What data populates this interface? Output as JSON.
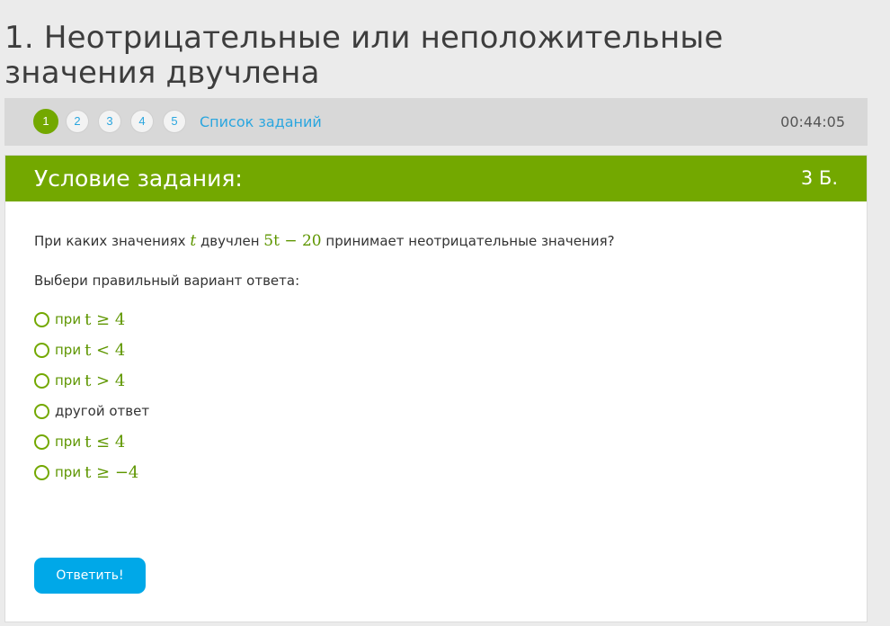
{
  "page": {
    "title": "1. Неотрицательные или неположительные значения двучлена"
  },
  "nav": {
    "pages": [
      "1",
      "2",
      "3",
      "4",
      "5"
    ],
    "active_page": "1",
    "task_list_label": "Список заданий",
    "timer": "00:44:05"
  },
  "task": {
    "header_title": "Условие задания:",
    "points": "3 Б.",
    "question": {
      "part1": "При каких значениях ",
      "var": "t",
      "part2": " двучлен ",
      "expr": "5t − 20",
      "part3": " принимает неотрицательные  значения?"
    },
    "choose_label": "Выбери правильный вариант ответа:",
    "options": [
      {
        "prefix": "при",
        "math": "t ≥ 4"
      },
      {
        "prefix": "при",
        "math": "t < 4"
      },
      {
        "prefix": "при",
        "math": "t > 4"
      },
      {
        "prefix": "",
        "text": "другой ответ"
      },
      {
        "prefix": "при",
        "math": "t ≤ 4"
      },
      {
        "prefix": "при",
        "math": "t ≥ −4"
      }
    ],
    "submit_label": "Ответить!"
  },
  "colors": {
    "accent_green": "#73a800",
    "link_blue": "#2aa6df",
    "button_blue": "#00a8e8"
  }
}
